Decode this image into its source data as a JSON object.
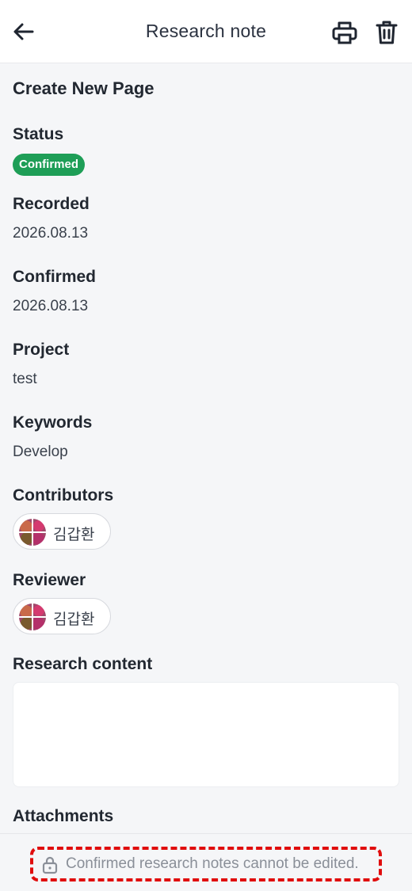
{
  "header": {
    "title": "Research note",
    "back_icon": "arrow-left-icon",
    "print_icon": "printer-icon",
    "delete_icon": "trash-icon"
  },
  "page": {
    "title": "Create New Page"
  },
  "fields": {
    "status": {
      "label": "Status",
      "value": "Confirmed",
      "color": "#1e9e57"
    },
    "recorded": {
      "label": "Recorded",
      "value": "2026.08.13"
    },
    "confirmed": {
      "label": "Confirmed",
      "value": "2026.08.13"
    },
    "project": {
      "label": "Project",
      "value": "test"
    },
    "keywords": {
      "label": "Keywords",
      "value": "Develop"
    },
    "contributors": {
      "label": "Contributors",
      "people": [
        {
          "name": "김갑환"
        }
      ]
    },
    "reviewer": {
      "label": "Reviewer",
      "people": [
        {
          "name": "김갑환"
        }
      ]
    },
    "research_content": {
      "label": "Research content",
      "value": ""
    },
    "attachments": {
      "label": "Attachments"
    }
  },
  "footer": {
    "lock_icon": "lock-icon",
    "message": "Confirmed research notes cannot be edited.",
    "highlight_color": "#e00d0d"
  }
}
